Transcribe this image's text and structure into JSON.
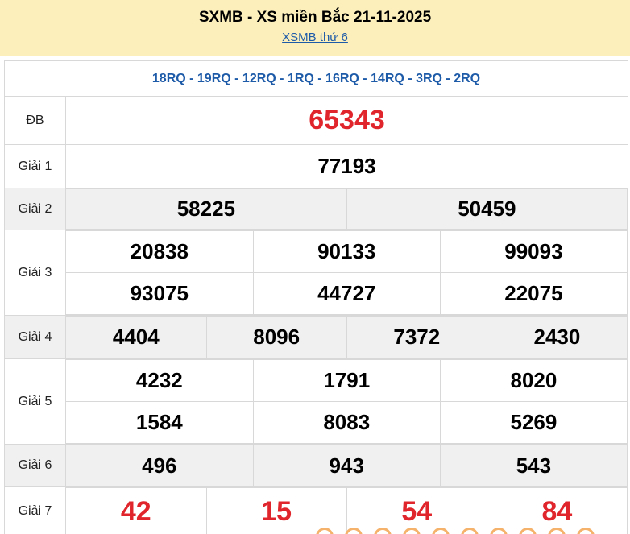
{
  "header": {
    "title": "SXMB - XS miền Bắc 21-11-2025",
    "sub_link": "XSMB thứ 6"
  },
  "codes": "18RQ - 19RQ - 12RQ - 1RQ - 16RQ - 14RQ - 3RQ - 2RQ",
  "prizes": {
    "db": {
      "label": "ĐB",
      "values": [
        "65343"
      ]
    },
    "g1": {
      "label": "Giải 1",
      "values": [
        "77193"
      ]
    },
    "g2": {
      "label": "Giải 2",
      "values": [
        "58225",
        "50459"
      ]
    },
    "g3": {
      "label": "Giải 3",
      "values": [
        "20838",
        "90133",
        "99093",
        "93075",
        "44727",
        "22075"
      ]
    },
    "g4": {
      "label": "Giải 4",
      "values": [
        "4404",
        "8096",
        "7372",
        "2430"
      ]
    },
    "g5": {
      "label": "Giải 5",
      "values": [
        "4232",
        "1791",
        "8020",
        "1584",
        "8083",
        "5269"
      ]
    },
    "g6": {
      "label": "Giải 6",
      "values": [
        "496",
        "943",
        "543"
      ]
    },
    "g7": {
      "label": "Giải 7",
      "values": [
        "42",
        "15",
        "54",
        "84"
      ]
    }
  },
  "colors": {
    "header_bg": "#fcefbc",
    "link": "#1d5aa8",
    "red": "#e0262c",
    "gray_row": "#f0f0f0"
  }
}
